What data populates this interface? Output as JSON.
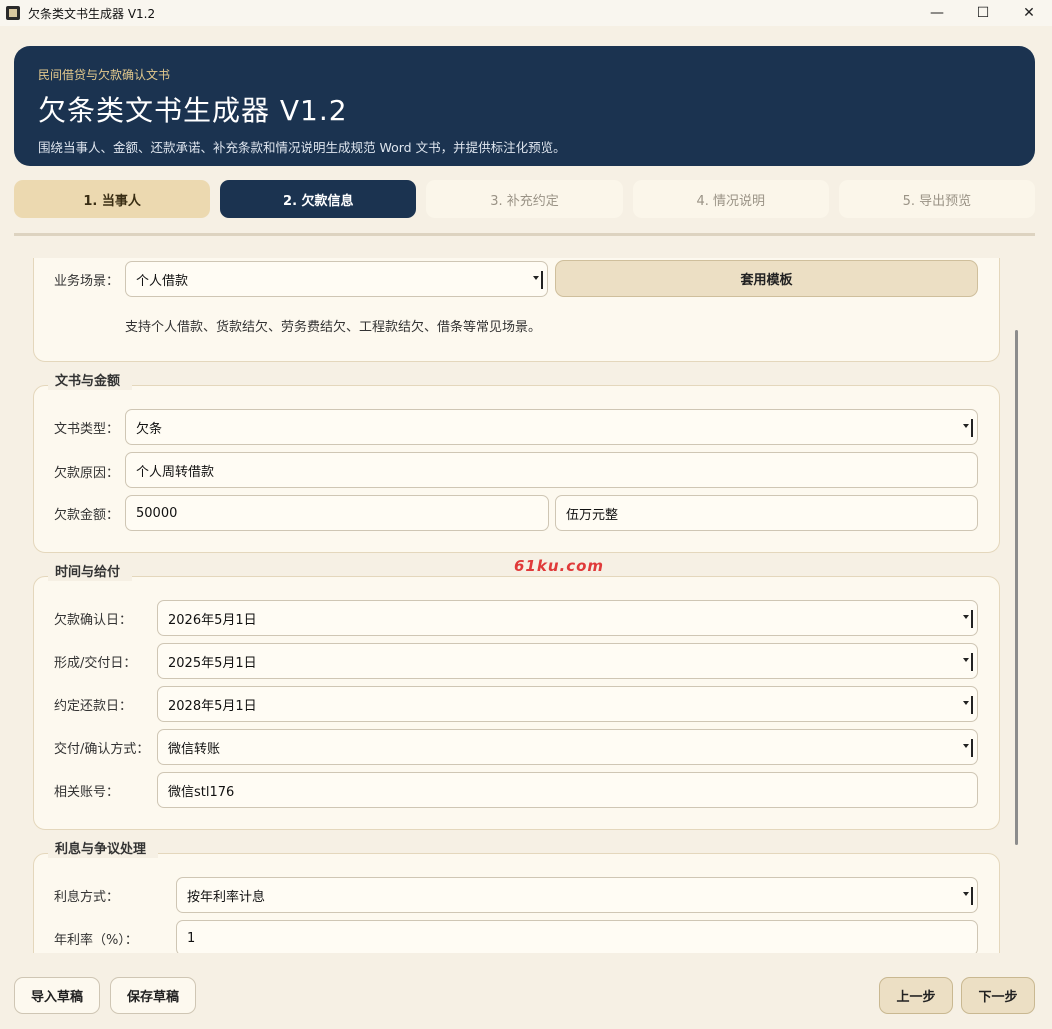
{
  "window": {
    "title": "欠条类文书生成器 V1.2",
    "controls": [
      "—",
      "☐",
      "✕"
    ]
  },
  "banner": {
    "kicker": "民间借贷与欠款确认文书",
    "title": "欠条类文书生成器 V1.2",
    "description": "围绕当事人、金额、还款承诺、补充条款和情况说明生成规范 Word 文书，并提供标注化预览。"
  },
  "steps": [
    {
      "label": "1. 当事人",
      "state": "done"
    },
    {
      "label": "2. 欠款信息",
      "state": "active"
    },
    {
      "label": "3. 补充约定",
      "state": "todo"
    },
    {
      "label": "4. 情况说明",
      "state": "todo"
    },
    {
      "label": "5. 导出预览",
      "state": "todo"
    }
  ],
  "scenario": {
    "label": "业务场景：",
    "value": "个人借款",
    "apply_button": "套用模板",
    "hint": "支持个人借款、货款结欠、劳务费结欠、工程款结欠、借条等常见场景。"
  },
  "doc_amount": {
    "title": "文书与金额",
    "doc_type_label": "文书类型：",
    "doc_type_value": "欠条",
    "reason_label": "欠款原因：",
    "reason_value": "个人周转借款",
    "amount_label": "欠款金额：",
    "amount_value": "50000",
    "amount_upper": "伍万元整"
  },
  "time_payment": {
    "title": "时间与给付",
    "confirm_date_label": "欠款确认日：",
    "confirm_date_value": "2026年5月1日",
    "formed_date_label": "形成/交付日：",
    "formed_date_value": "2025年5月1日",
    "repay_date_label": "约定还款日：",
    "repay_date_value": "2028年5月1日",
    "method_label": "交付/确认方式：",
    "method_value": "微信转账",
    "account_label": "相关账号：",
    "account_value": "微信stl176"
  },
  "interest": {
    "title": "利息与争议处理",
    "mode_label": "利息方式：",
    "mode_value": "按年利率计息",
    "rate_label": "年利率（%）：",
    "rate_value": "1"
  },
  "watermark": "61ku.com",
  "footer": {
    "import_draft": "导入草稿",
    "save_draft": "保存草稿",
    "prev": "上一步",
    "next": "下一步"
  },
  "colors": {
    "navy": "#1b3350",
    "tan": "#ecd9b0",
    "cream": "#fdf9ef",
    "background": "#f6f0e4"
  }
}
